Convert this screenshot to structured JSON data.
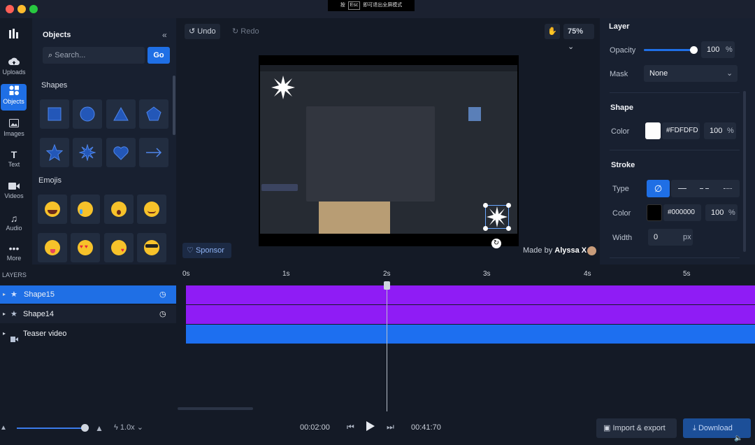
{
  "fullscreen_hint": {
    "prefix": "按",
    "key": "Esc",
    "suffix": "即可退出全屏模式"
  },
  "rail": [
    {
      "label": "Uploads",
      "icon": "cloud-upload-icon"
    },
    {
      "label": "Objects",
      "icon": "objects-icon"
    },
    {
      "label": "Images",
      "icon": "image-icon"
    },
    {
      "label": "Text",
      "icon": "text-icon"
    },
    {
      "label": "Videos",
      "icon": "video-icon"
    },
    {
      "label": "Audio",
      "icon": "audio-icon"
    },
    {
      "label": "More",
      "icon": "more-icon"
    }
  ],
  "objects": {
    "title": "Objects",
    "search_placeholder": "Search...",
    "go_label": "Go",
    "shapes_title": "Shapes",
    "emojis_title": "Emojis"
  },
  "toolbar": {
    "undo": "Undo",
    "redo": "Redo",
    "zoom": "75%"
  },
  "canvas": {
    "sponsor": "Sponsor",
    "made_by": "Made by",
    "author": "Alyssa X"
  },
  "layer_panel": {
    "title": "Layer",
    "opacity_label": "Opacity",
    "opacity_value": "100",
    "opacity_unit": "%",
    "opacity_level": 1.0,
    "mask_label": "Mask",
    "mask_value": "None"
  },
  "shape_panel": {
    "title": "Shape",
    "color_label": "Color",
    "color_hex": "#FDFDFD",
    "color_value": "#FDFDFD",
    "alpha": "100",
    "alpha_unit": "%"
  },
  "stroke_panel": {
    "title": "Stroke",
    "type_label": "Type",
    "color_label": "Color",
    "color_hex": "#000000",
    "color_value": "#000000",
    "alpha": "100",
    "alpha_unit": "%",
    "width_label": "Width",
    "width_value": "0",
    "width_unit": "px"
  },
  "layers": {
    "title": "LAYERS",
    "items": [
      {
        "name": "Shape15",
        "selected": true
      },
      {
        "name": "Shape14",
        "selected": false
      },
      {
        "name": "Teaser video",
        "selected": false
      }
    ]
  },
  "timeline": {
    "ticks": [
      "0s",
      "1s",
      "2s",
      "3s",
      "4s",
      "5s"
    ],
    "colors": {
      "shape": "#8f1cf5",
      "video": "#1d6ff0"
    }
  },
  "footer": {
    "speed": "1.0x",
    "current_time": "00:02:00",
    "total_time": "00:41:70",
    "import_export": "Import & export",
    "download": "Download"
  }
}
